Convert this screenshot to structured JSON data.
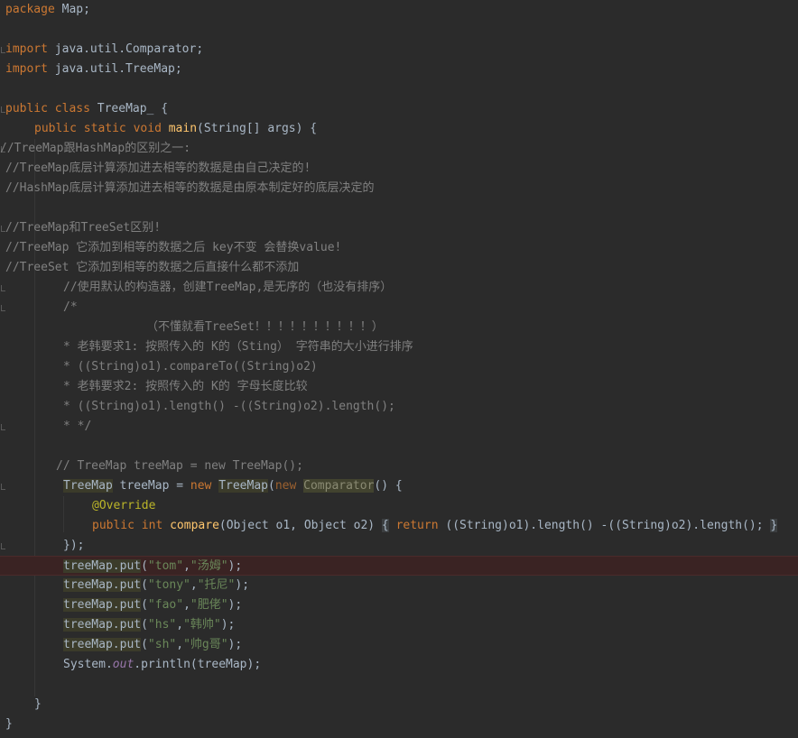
{
  "code": {
    "l1": {
      "kw": "package",
      "rest": " Map;"
    },
    "l2": {
      "kw": "import",
      "rest": " java.util.Comparator;"
    },
    "l3": {
      "kw": "import",
      "rest": " java.util.TreeMap;"
    },
    "l4": {
      "kw1": "public",
      "kw2": "class",
      "name": " TreeMap_ {"
    },
    "l5": {
      "kw1": "public",
      "kw2": "static",
      "kw3": "void",
      "fn": "main",
      "rest": "(String[] args) {"
    },
    "c1": "//TreeMap跟HashMap的区别之一:",
    "c2": "//TreeMap底层计算添加进去相等的数据是由自己决定的!",
    "c3": "//HashMap底层计算添加进去相等的数据是由原本制定好的底层决定的",
    "c4": "//TreeMap和TreeSet区别!",
    "c5": "//TreeMap 它添加到相等的数据之后 key不变 会替换value!",
    "c6": "//TreeSet 它添加到相等的数据之后直接什么都不添加",
    "c7": "//使用默认的构造器，创建TreeMap,是无序的（也没有排序）",
    "c8": "/*",
    "c9": "（不懂就看TreeSet！！！！！！！！！！）",
    "c10": "* 老韩要求1: 按照传入的 K的（Sting） 字符串的大小进行排序",
    "c11": "* ((String)o1).compareTo((String)o2)",
    "c12": "* 老韩要求2: 按照传入的 K的 字母长度比较",
    "c13": "* ((String)o1).length() -((String)o2).length();",
    "c14": "* */",
    "c15": "// TreeMap treeMap = new TreeMap();",
    "decl": {
      "type": "TreeMap",
      "var": " treeMap = ",
      "kwnew": "new",
      "ctor": "TreeMap",
      "paren": "(",
      "kwnew2": "new",
      "anon": "Comparator",
      "tail": "() {"
    },
    "override": "@Override",
    "compare": {
      "kw1": "public",
      "kw2": "int",
      "fn": "compare",
      "params": "(Object o1, Object o2)",
      "brace1": "{",
      "ret": "return",
      "body": " ((String)o1).length() -((String)o2).length();",
      "brace2": "}"
    },
    "close_anon": "});",
    "puts": [
      {
        "obj": "treeMap.put",
        "k": "\"tom\"",
        "v": "\"汤姆\""
      },
      {
        "obj": "treeMap.put",
        "k": "\"tony\"",
        "v": "\"托尼\""
      },
      {
        "obj": "treeMap.put",
        "k": "\"fao\"",
        "v": "\"肥佬\""
      },
      {
        "obj": "treeMap.put",
        "k": "\"hs\"",
        "v": "\"韩帅\""
      },
      {
        "obj": "treeMap.put",
        "k": "\"sh\"",
        "v": "\"帅g哥\""
      }
    ],
    "println": {
      "pre": "System.",
      "out": "out",
      "post": ".println(treeMap);"
    },
    "close_main": "}",
    "close_class": "}"
  }
}
